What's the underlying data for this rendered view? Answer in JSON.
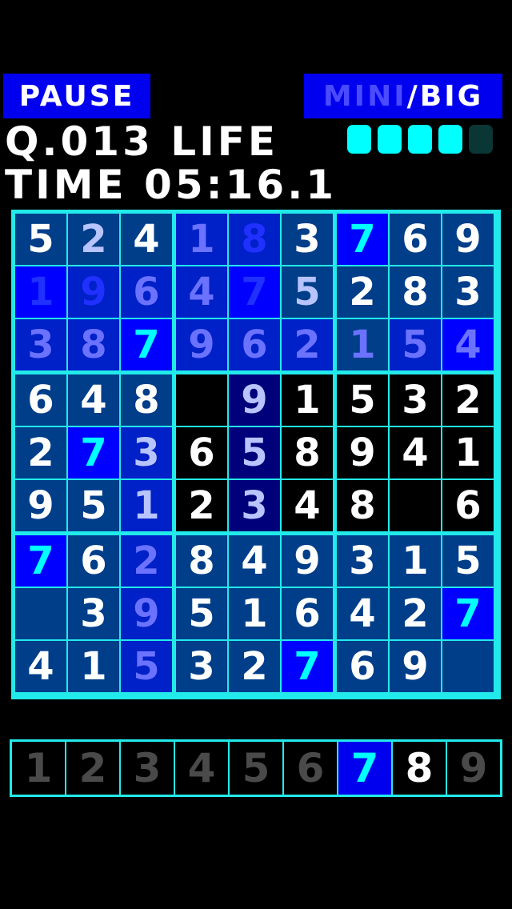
{
  "header": {
    "pause_label": "PAUSE",
    "mini_label": "MINI",
    "slash": "/",
    "big_label": "BIG",
    "question": "Q.013",
    "life_label": "LIFE",
    "life_total": 5,
    "life_remaining": 4,
    "time_label": "TIME",
    "time_value": "05:16.1"
  },
  "colors": {
    "accent": "#22eaea",
    "button_bg": "#0000ee",
    "cell_default": "#003e8a",
    "cell_bright": "#0000ff",
    "cell_medium": "#0020c8",
    "cell_dark": "#00007a",
    "cell_empty": "#000000",
    "digit_white": "#ffffff",
    "digit_cyan": "#00ffff",
    "digit_light": "#b8c4ff",
    "digit_faint": "#6a72ff",
    "digit_dim": "#2030ff"
  },
  "board": {
    "rows": [
      [
        "5",
        "2",
        "4",
        "1",
        "8",
        "3",
        "7",
        "6",
        "9"
      ],
      [
        "1",
        "9",
        "6",
        "4",
        "7",
        "5",
        "2",
        "8",
        "3"
      ],
      [
        "3",
        "8",
        "7",
        "9",
        "6",
        "2",
        "1",
        "5",
        "4"
      ],
      [
        "6",
        "4",
        "8",
        "",
        "9",
        "1",
        "5",
        "3",
        "2"
      ],
      [
        "2",
        "7",
        "3",
        "6",
        "5",
        "8",
        "9",
        "4",
        "1"
      ],
      [
        "9",
        "5",
        "1",
        "2",
        "3",
        "4",
        "8",
        "",
        "6"
      ],
      [
        "7",
        "6",
        "2",
        "8",
        "4",
        "9",
        "3",
        "1",
        "5"
      ],
      [
        "",
        "3",
        "9",
        "5",
        "1",
        "6",
        "4",
        "2",
        "7"
      ],
      [
        "4",
        "1",
        "5",
        "3",
        "2",
        "7",
        "6",
        "9",
        ""
      ]
    ],
    "cell_bg": [
      [
        "d",
        "d",
        "d",
        "m",
        "m",
        "d",
        "b",
        "d",
        "d"
      ],
      [
        "b",
        "m",
        "m",
        "m",
        "b",
        "d",
        "d",
        "d",
        "d"
      ],
      [
        "m",
        "m",
        "b",
        "m",
        "m",
        "m",
        "d",
        "m",
        "b"
      ],
      [
        "d",
        "d",
        "d",
        "e",
        "k",
        "e",
        "e",
        "e",
        "e"
      ],
      [
        "d",
        "b",
        "m",
        "e",
        "k",
        "e",
        "e",
        "e",
        "e"
      ],
      [
        "d",
        "d",
        "m",
        "e",
        "k",
        "e",
        "e",
        "e",
        "e"
      ],
      [
        "b",
        "d",
        "m",
        "d",
        "d",
        "d",
        "d",
        "d",
        "d"
      ],
      [
        "d",
        "d",
        "m",
        "d",
        "d",
        "d",
        "d",
        "d",
        "b"
      ],
      [
        "d",
        "d",
        "m",
        "d",
        "d",
        "b",
        "d",
        "d",
        "d"
      ]
    ],
    "digit_color": [
      [
        "w",
        "l",
        "w",
        "f",
        "d",
        "w",
        "c",
        "w",
        "w"
      ],
      [
        "d",
        "d",
        "f",
        "f",
        "d",
        "l",
        "w",
        "w",
        "w"
      ],
      [
        "f",
        "f",
        "c",
        "f",
        "f",
        "f",
        "f",
        "f",
        "f"
      ],
      [
        "w",
        "w",
        "w",
        "w",
        "l",
        "w",
        "w",
        "w",
        "w"
      ],
      [
        "w",
        "c",
        "l",
        "w",
        "l",
        "w",
        "w",
        "w",
        "w"
      ],
      [
        "w",
        "w",
        "l",
        "w",
        "l",
        "w",
        "w",
        "w",
        "w"
      ],
      [
        "c",
        "w",
        "f",
        "w",
        "w",
        "w",
        "w",
        "w",
        "w"
      ],
      [
        "w",
        "w",
        "f",
        "w",
        "w",
        "w",
        "w",
        "w",
        "c"
      ],
      [
        "w",
        "w",
        "f",
        "w",
        "w",
        "c",
        "w",
        "w",
        "w"
      ]
    ]
  },
  "picker": {
    "digits": [
      "1",
      "2",
      "3",
      "4",
      "5",
      "6",
      "7",
      "8",
      "9"
    ],
    "selected": "7",
    "available": [
      "8"
    ]
  }
}
